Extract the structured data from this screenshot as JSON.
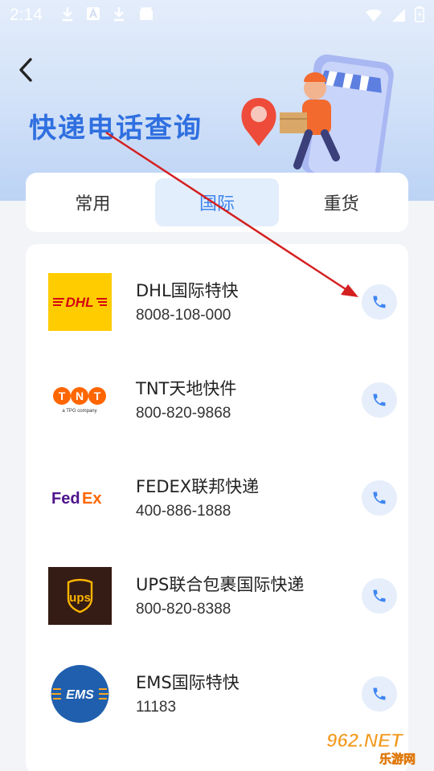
{
  "status_bar": {
    "time": "2:14"
  },
  "header": {
    "title": "快递电话查询"
  },
  "tabs": [
    {
      "label": "常用",
      "active": false
    },
    {
      "label": "国际",
      "active": true
    },
    {
      "label": "重货",
      "active": false
    }
  ],
  "couriers": [
    {
      "name": "DHL国际特快",
      "phone": "8008-108-000",
      "logo_text": "DHL",
      "logo_bg": "#ffcc00",
      "logo_fg": "#d40511"
    },
    {
      "name": "TNT天地快件",
      "phone": "800-820-9868",
      "logo_text": "TNT",
      "logo_sub": "a TPG company",
      "logo_bg": "#ffffff",
      "logo_fg": "#ff6600"
    },
    {
      "name": "FEDEX联邦快递",
      "phone": "400-886-1888",
      "logo_text_a": "Fed",
      "logo_text_b": "Ex",
      "logo_bg": "#ffffff",
      "logo_fg_a": "#4d148c",
      "logo_fg_b": "#ff6600"
    },
    {
      "name": "UPS联合包裹国际快递",
      "phone": "800-820-8388",
      "logo_text": "ups",
      "logo_bg": "#351c15",
      "logo_fg": "#ffb500"
    },
    {
      "name": "EMS国际特快",
      "phone": "11183",
      "logo_text": "EMS",
      "logo_bg": "#1f5fae",
      "logo_fg": "#ffffff"
    }
  ],
  "watermark": {
    "main": "962.NET",
    "sub": "乐游网"
  },
  "colors": {
    "accent": "#3f86f0",
    "title_blue": "#2f6fe0",
    "arrow_red": "#d42020"
  }
}
